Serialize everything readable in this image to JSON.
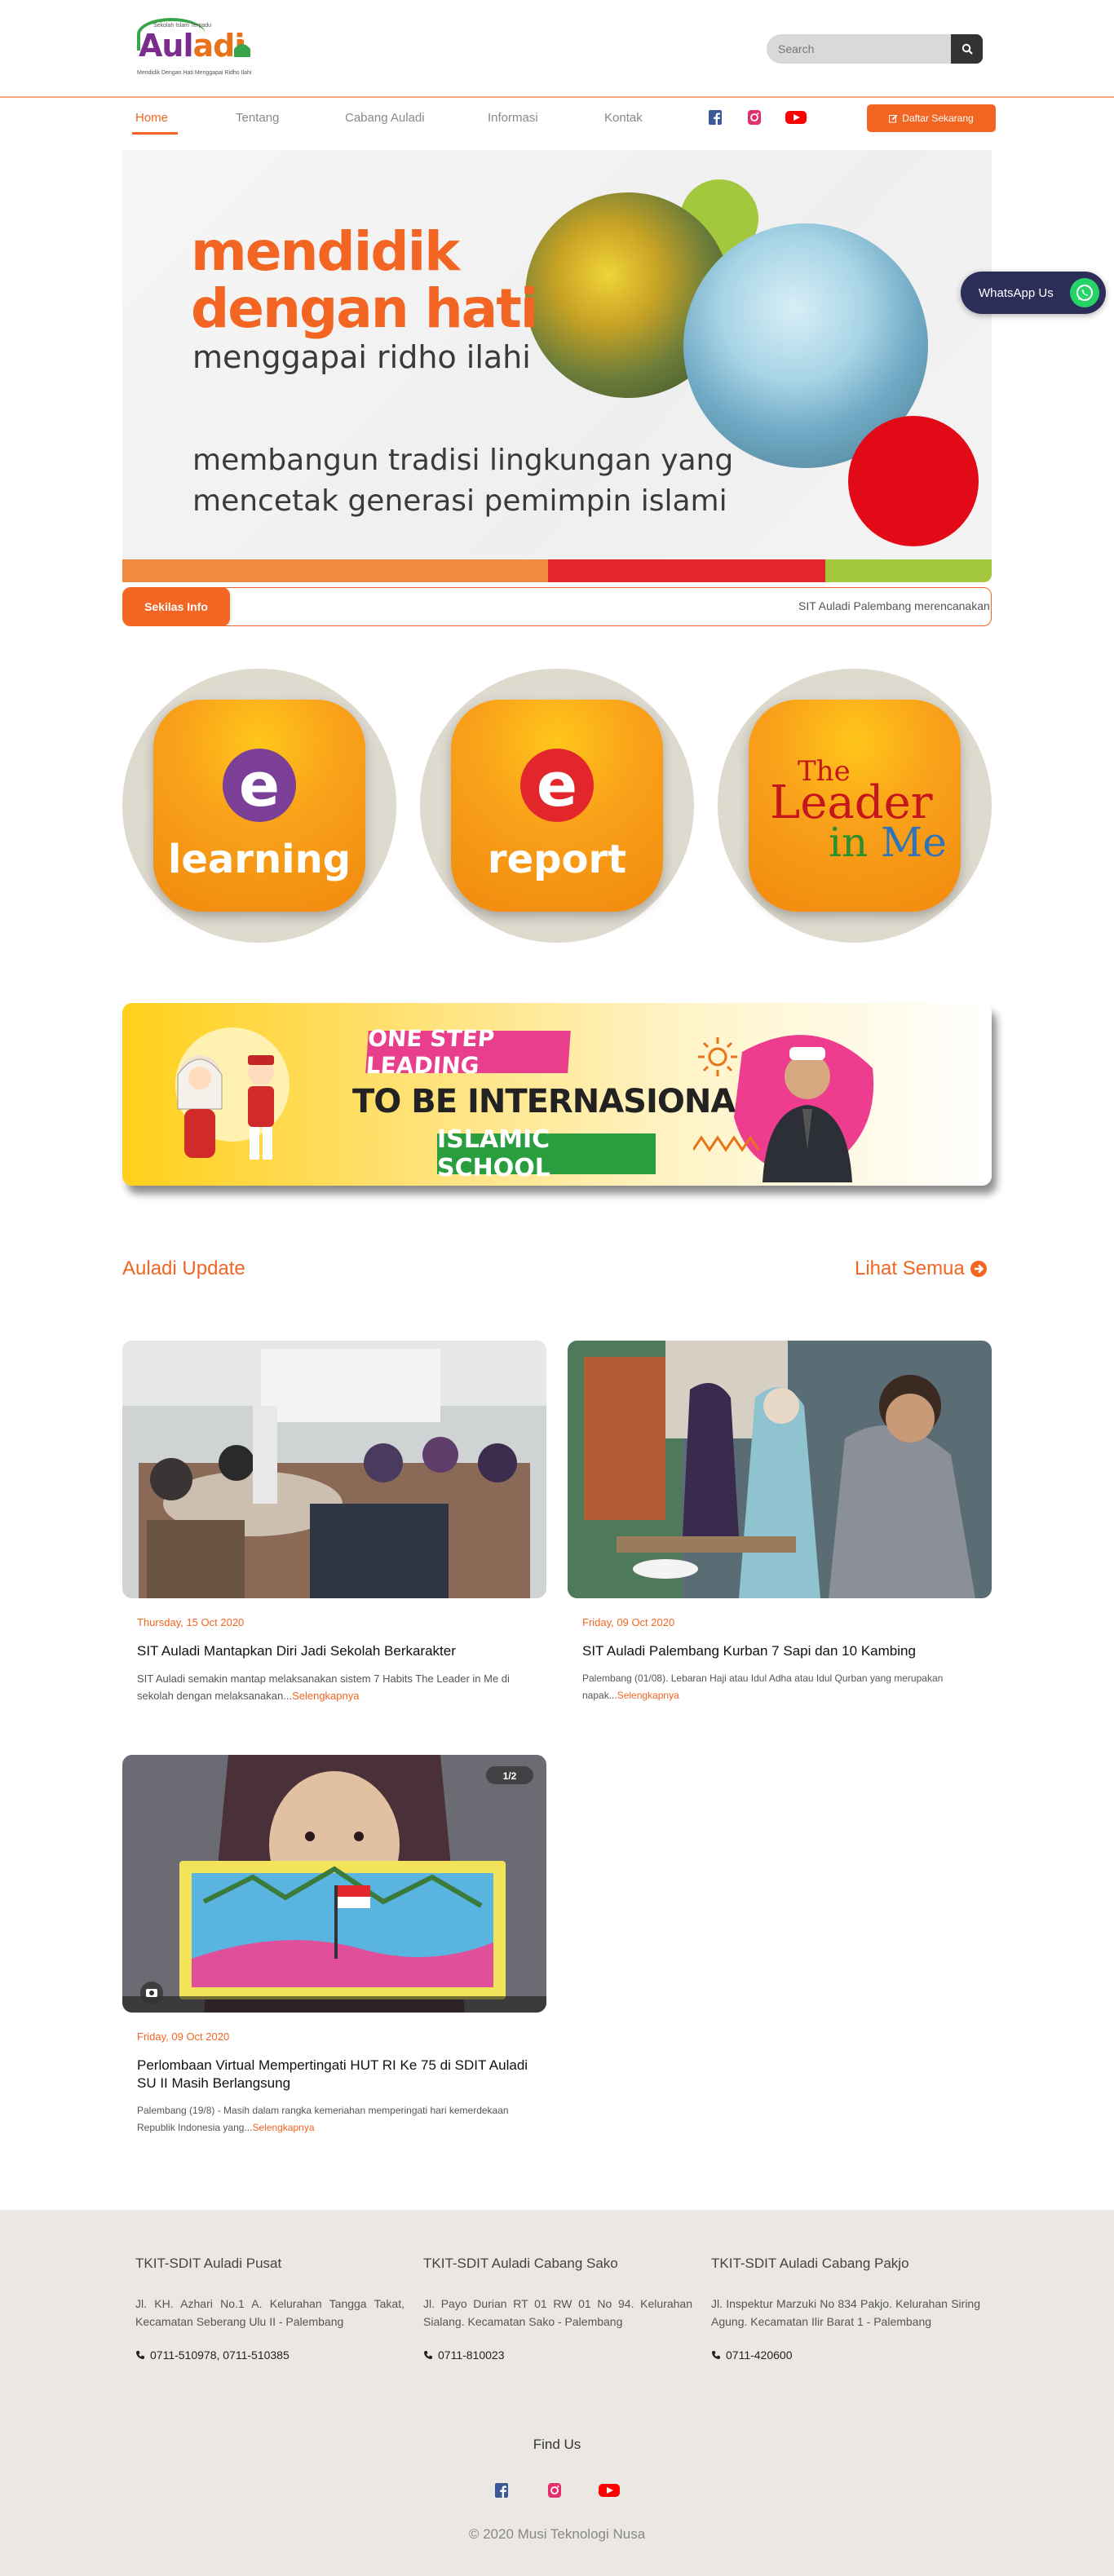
{
  "brand": {
    "small": "Sekolah Islam Terpadu",
    "name_a": "Aul",
    "name_b": "adi",
    "tagline": "Mendidik Dengan Hati Menggapai Ridho Ilahi"
  },
  "search": {
    "placeholder": "Search"
  },
  "nav": {
    "items": [
      {
        "label": "Home"
      },
      {
        "label": "Tentang"
      },
      {
        "label": "Cabang Auladi"
      },
      {
        "label": "Informasi"
      },
      {
        "label": "Kontak"
      }
    ],
    "cta": "Daftar Sekarang"
  },
  "hero": {
    "line1": "mendidik",
    "line2": "dengan hati",
    "line3": "menggapai ridho ilahi",
    "line4": "membangun tradisi lingkungan yang",
    "line5": "mencetak generasi pemimpin islami"
  },
  "whatsapp": {
    "label": "WhatsApp Us"
  },
  "info": {
    "label": "Sekilas Info",
    "text": "SIT Auladi Palembang merencanakan"
  },
  "tiles": [
    {
      "title": "learning",
      "letter": "e"
    },
    {
      "title": "report",
      "letter": "e"
    },
    {
      "the": "The",
      "leader": "Leader",
      "in": "in",
      "me": "Me"
    }
  ],
  "banner": {
    "top": "ONE STEP LEADING",
    "middle": "TO BE INTERNASIONAL",
    "bottom": "ISLAMIC SCHOOL"
  },
  "updates": {
    "title": "Auladi Update",
    "more": "Lihat Semua",
    "posts": [
      {
        "date": "Thursday, 15 Oct 2020",
        "title": "SIT Auladi Mantapkan Diri Jadi Sekolah Berkarakter",
        "excerpt": "SIT Auladi semakin mantap melaksanakan sistem 7 Habits The Leader in Me di sekolah dengan melaksanakan...",
        "more": "Selengkapnya"
      },
      {
        "date": "Friday, 09 Oct 2020",
        "title": "SIT Auladi Palembang Kurban 7 Sapi dan 10 Kambing",
        "excerpt": "Palembang (01/08). Lebaran Haji atau Idul Adha atau Idul Qurban yang merupakan napak...",
        "more": "Selengkapnya"
      },
      {
        "date": "Friday, 09 Oct 2020",
        "title": "Perlombaan Virtual Mempertingati HUT RI Ke 75 di SDIT Auladi SU II Masih Berlangsung",
        "excerpt": "Palembang (19/8) - Masih dalam rangka kemeriahan memperingati hari kemerdekaan Republik Indonesia yang...",
        "more": "Selengkapnya",
        "badge": "1/2"
      }
    ]
  },
  "footer": {
    "columns": [
      {
        "title": "TKIT-SDIT Auladi Pusat",
        "address": "Jl. KH. Azhari No.1 A. Kelurahan Tangga Takat, Kecamatan Seberang Ulu II - Palembang",
        "phone": "0711-510978, 0711-510385"
      },
      {
        "title": "TKIT-SDIT Auladi Cabang Sako",
        "address": "Jl. Payo Durian RT 01 RW 01 No 94. Kelurahan Sialang. Kecamatan Sako - Palembang",
        "phone": "0711-810023"
      },
      {
        "title": "TKIT-SDIT Auladi Cabang Pakjo",
        "address": "Jl. Inspektur Marzuki No 834 Pakjo. Kelurahan Siring Agung. Kecamatan Ilir Barat 1 - Palembang",
        "phone": "0711-420600"
      }
    ],
    "find": "Find Us",
    "copyright": "© 2020 Musi Teknologi Nusa"
  },
  "colors": {
    "accent": "#f26522",
    "facebook": "#3b5998",
    "instagram": "#e1306c",
    "youtube": "#ff0000",
    "whatsapp": "#25d366",
    "hero_bar": [
      "#f08a3c",
      "#e3262c",
      "#a3c83d"
    ]
  },
  "icons": [
    "search-icon",
    "facebook-icon",
    "instagram-icon",
    "youtube-icon",
    "edit-icon",
    "whatsapp-icon",
    "arrow-circle-right-icon",
    "phone-icon",
    "camera-icon"
  ]
}
